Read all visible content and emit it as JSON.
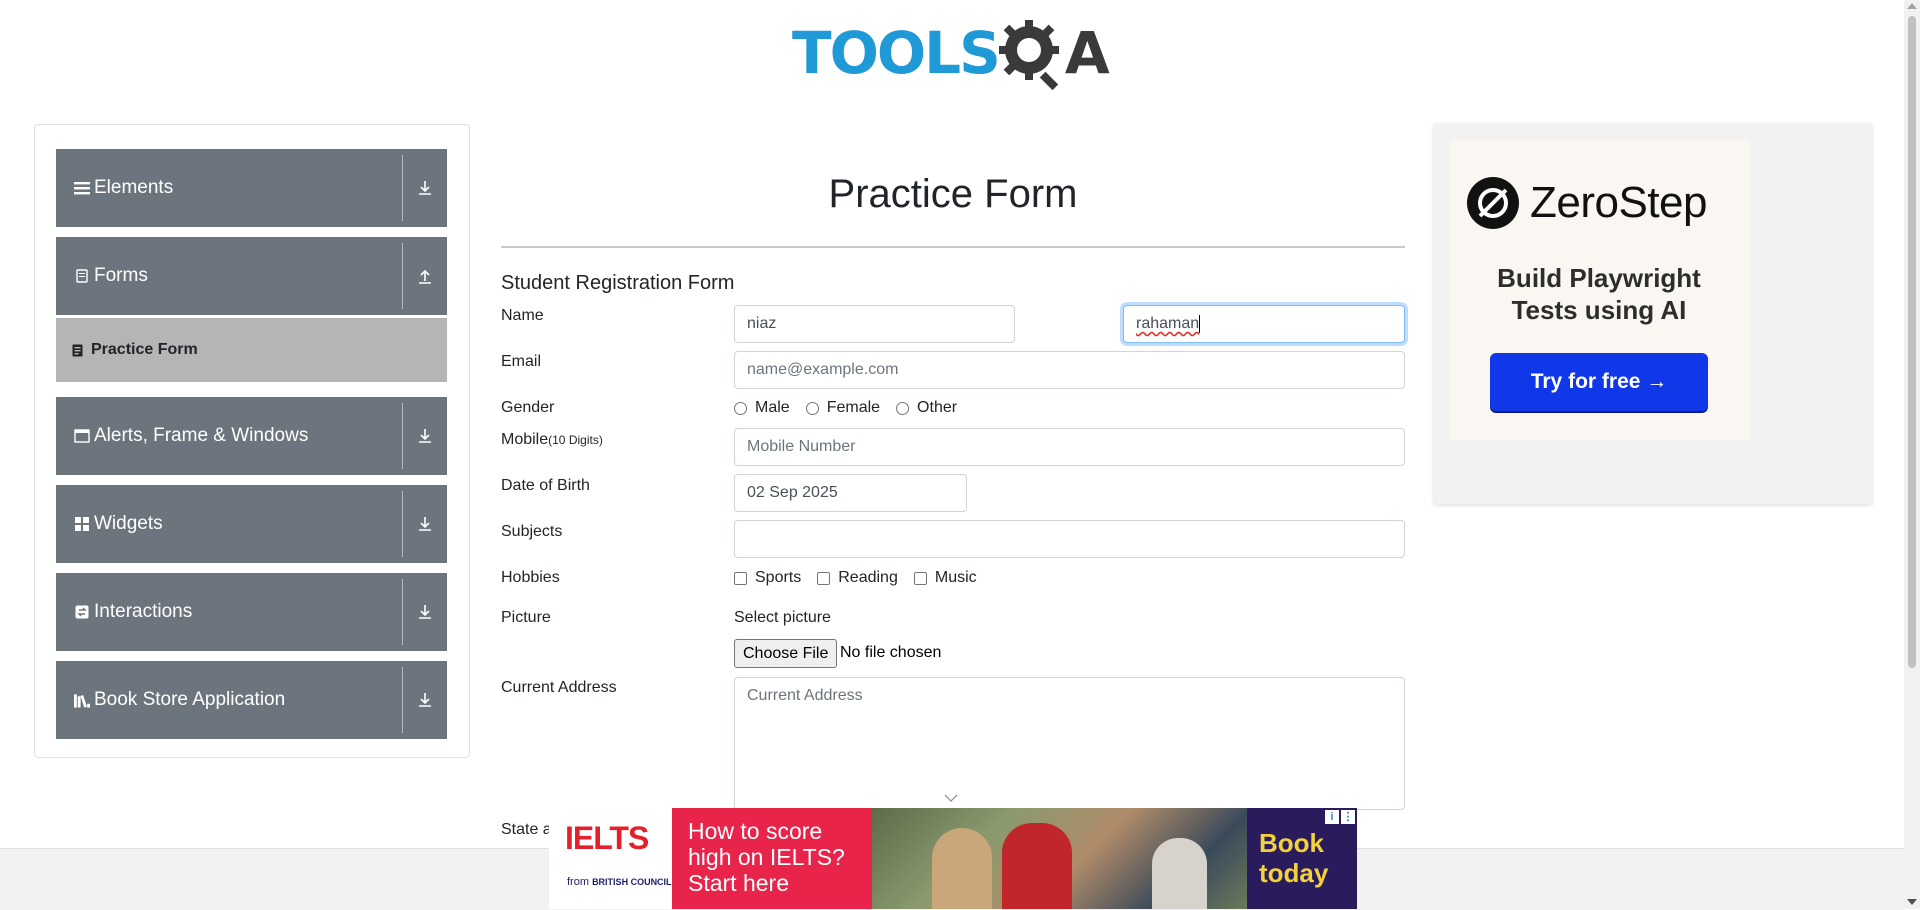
{
  "header": {
    "logo_tools": "TOOLS",
    "logo_qa": "A"
  },
  "sidebar": {
    "groups": [
      {
        "label": "Elements",
        "icon": "list-icon",
        "state": "collapsed"
      },
      {
        "label": "Forms",
        "icon": "document-icon",
        "state": "expanded"
      },
      {
        "label": "Alerts, Frame & Windows",
        "icon": "window-icon",
        "state": "collapsed"
      },
      {
        "label": "Widgets",
        "icon": "widgets-icon",
        "state": "collapsed"
      },
      {
        "label": "Interactions",
        "icon": "interactions-icon",
        "state": "collapsed"
      },
      {
        "label": "Book Store Application",
        "icon": "books-icon",
        "state": "collapsed"
      }
    ],
    "active_item": {
      "label": "Practice Form",
      "icon": "form-icon"
    }
  },
  "form": {
    "page_title": "Practice Form",
    "heading": "Student Registration Form",
    "name_label": "Name",
    "first_name_value": "niaz",
    "last_name_value": "rahaman",
    "email_label": "Email",
    "email_placeholder": "name@example.com",
    "gender_label": "Gender",
    "gender_options": [
      "Male",
      "Female",
      "Other"
    ],
    "mobile_label": "Mobile",
    "mobile_hint": "(10 Digits)",
    "mobile_placeholder": "Mobile Number",
    "dob_label": "Date of Birth",
    "dob_value": "02 Sep 2025",
    "subjects_label": "Subjects",
    "hobbies_label": "Hobbies",
    "hobby_options": [
      "Sports",
      "Reading",
      "Music"
    ],
    "picture_label": "Picture",
    "select_picture": "Select picture",
    "choose_file": "Choose File",
    "file_status": "No file chosen",
    "address_label": "Current Address",
    "address_placeholder": "Current Address",
    "state_label_partial": "State a"
  },
  "ad_right": {
    "brand": "ZeroStep",
    "headline_line1": "Build Playwright",
    "headline_line2": "Tests using AI",
    "cta": "Try for free →"
  },
  "ad_bottom": {
    "logo": "IELTS",
    "from": "from",
    "council": "BRITISH COUNCIL",
    "pitch_line1": "How to score",
    "pitch_line2": "high on IELTS?",
    "pitch_line3": "Start here",
    "cta_line1": "Book",
    "cta_line2": "today"
  },
  "colors": {
    "sidebar_group": "#6c757d",
    "active_item": "#b5b5b5",
    "logo_blue": "#1f9ad6",
    "cta_blue": "#1037e8",
    "ielts_pink": "#e8244a",
    "ielts_navy": "#2a1b5c"
  }
}
